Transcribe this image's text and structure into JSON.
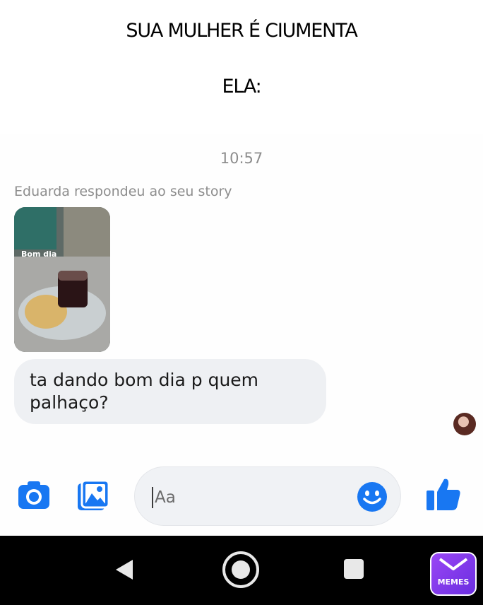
{
  "caption": {
    "line1": "SUA MULHER É CIUMENTA",
    "line2": "ELA:"
  },
  "chat": {
    "timestamp": "10:57",
    "reply_note": "Eduarda respondeu ao seu story",
    "story_label": "Bom dia",
    "message": "ta dando bom dia p quem palhaço?"
  },
  "composer": {
    "placeholder": "Aa",
    "accent_color": "#1877f2"
  },
  "watermark": {
    "text": "MEMES"
  },
  "icons": {
    "camera": "camera-icon",
    "gallery": "gallery-icon",
    "emoji": "smiley-icon",
    "like": "thumbs-up-icon",
    "back": "back-triangle-icon",
    "home": "home-circle-icon",
    "recents": "recents-square-icon"
  }
}
